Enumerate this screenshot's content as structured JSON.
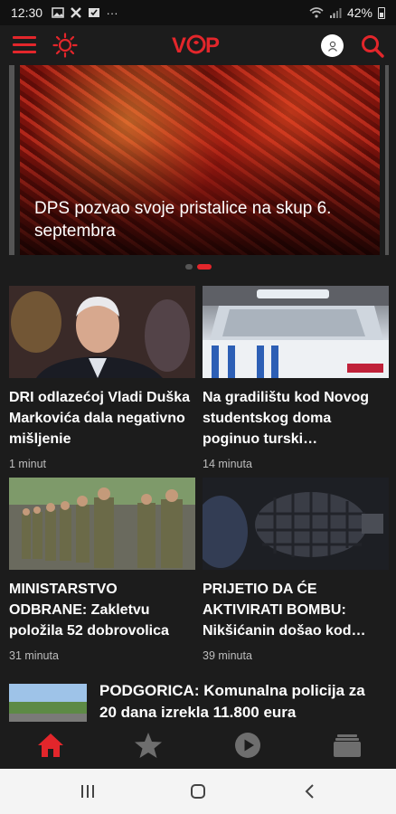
{
  "status_bar": {
    "time": "12:30",
    "battery": "42%",
    "icons": [
      "image-icon",
      "close-x-icon",
      "mail-check-icon",
      "more-dots-icon",
      "wifi-icon",
      "signal-icon",
      "battery-icon"
    ]
  },
  "header": {
    "logo_text": "VOP",
    "brand_color": "#e3262b"
  },
  "hero": {
    "title": "DPS pozvao svoje pristalice na skup 6. septembra",
    "pager_total": 2,
    "pager_active": 2
  },
  "cards": [
    {
      "title": "DRI odlazećoj Vladi Duška Markovića dala negativno mišljenie",
      "time": "1 minut"
    },
    {
      "title": "Na gradilištu kod Novog studentskog doma poginuo turski…",
      "time": "14 minuta"
    },
    {
      "title": "MINISTARSTVO ODBRANE: Zakletvu položila 52 dobrovolica",
      "time": "31 minuta"
    },
    {
      "title": "PRIJETIO DA ĆE AKTIVIRATI BOMBU: Nikšićanin došao kod…",
      "time": "39 minuta"
    }
  ],
  "list_item": {
    "title": "PODGORICA: Komunalna policija za 20 dana izrekla 11.800 eura"
  },
  "bottom_nav": {
    "items": [
      {
        "icon": "home-icon",
        "active": true
      },
      {
        "icon": "star-icon",
        "active": false
      },
      {
        "icon": "play-icon",
        "active": false
      },
      {
        "icon": "archive-icon",
        "active": false
      }
    ],
    "active_color": "#e3262b",
    "inactive_color": "#6e6e6e"
  }
}
